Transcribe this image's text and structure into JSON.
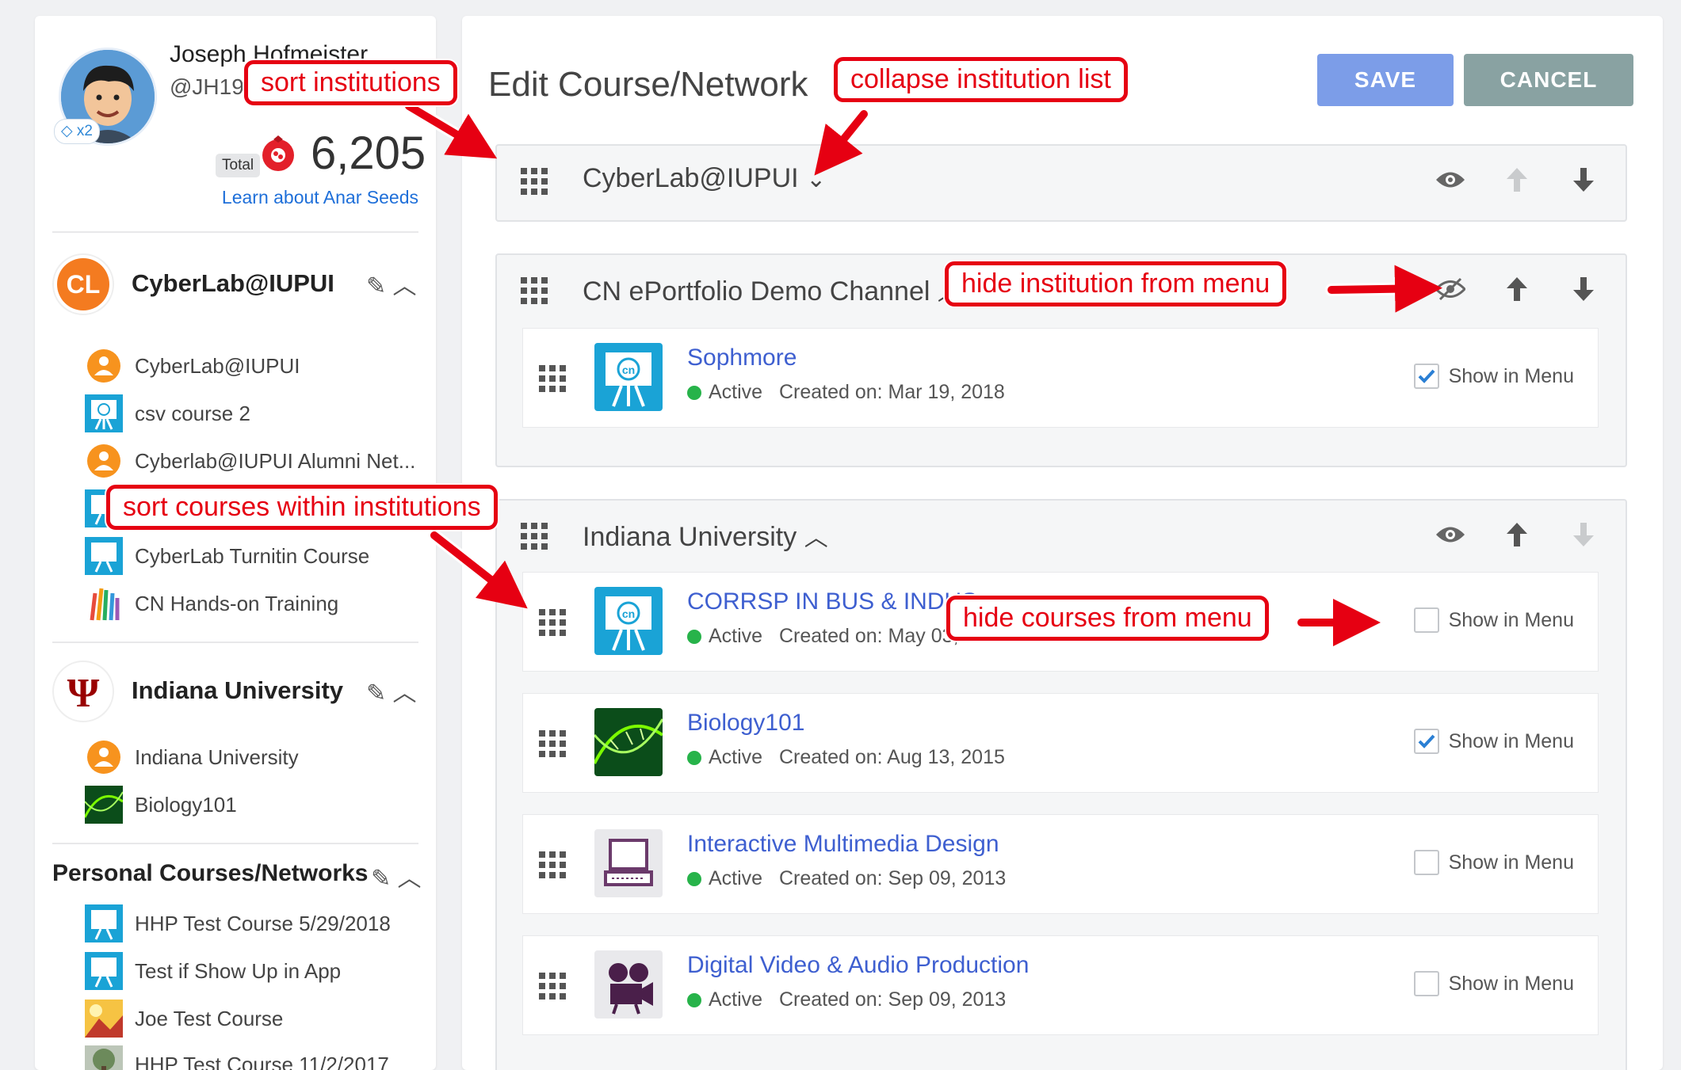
{
  "user": {
    "name": "Joseph Hofmeister",
    "handle": "@JH19",
    "gem_badge": "x2",
    "total_label": "Total",
    "points": "6,205",
    "learn_link": "Learn about Anar Seeds"
  },
  "sidebar": {
    "institutions": [
      {
        "title": "CyberLab@IUPUI",
        "logo": "CL",
        "items": [
          {
            "label": "CyberLab@IUPUI",
            "icon": "network-icon"
          },
          {
            "label": "csv course 2",
            "icon": "course-easel-icon"
          },
          {
            "label": "Cyberlab@IUPUI Alumni Net...",
            "icon": "network-icon"
          },
          {
            "label": "",
            "icon": "course-easel-icon"
          },
          {
            "label": "CyberLab Turnitin Course",
            "icon": "course-easel-icon"
          },
          {
            "label": "CN Hands-on Training",
            "icon": "hands-icon"
          }
        ]
      },
      {
        "title": "Indiana University",
        "logo": "IU",
        "items": [
          {
            "label": "Indiana University",
            "icon": "network-icon"
          },
          {
            "label": "Biology101",
            "icon": "biology-icon"
          }
        ]
      }
    ],
    "personal": {
      "title": "Personal Courses/Networks",
      "items": [
        {
          "label": "HHP Test Course 5/29/2018",
          "icon": "course-easel-icon"
        },
        {
          "label": "Test if Show Up in App",
          "icon": "course-easel-icon"
        },
        {
          "label": "Joe Test Course",
          "icon": "photo-icon"
        },
        {
          "label": "HHP Test Course 11/2/2017",
          "icon": "tree-icon"
        }
      ]
    }
  },
  "main": {
    "title": "Edit Course/Network",
    "save_label": "SAVE",
    "cancel_label": "CANCEL",
    "show_in_menu": "Show in Menu",
    "panels": [
      {
        "title": "CyberLab@IUPUI",
        "courses": []
      },
      {
        "title": "CN ePortfolio Demo Channel",
        "courses": [
          {
            "name": "Sophmore",
            "status": "Active",
            "created": "Created on: Mar 19, 2018",
            "show": true,
            "thumb": "course-easel-icon"
          }
        ]
      },
      {
        "title": "Indiana University",
        "courses": [
          {
            "name": "CORRSP IN BUS & INDUS",
            "status": "Active",
            "created": "Created on: May 03, 2017",
            "show": false,
            "thumb": "course-easel-icon"
          },
          {
            "name": "Biology101",
            "status": "Active",
            "created": "Created on: Aug 13, 2015",
            "show": true,
            "thumb": "biology-icon"
          },
          {
            "name": "Interactive Multimedia Design",
            "status": "Active",
            "created": "Created on: Sep 09, 2013",
            "show": false,
            "thumb": "computer-icon"
          },
          {
            "name": "Digital Video & Audio Production",
            "status": "Active",
            "created": "Created on: Sep 09, 2013",
            "show": false,
            "thumb": "film-projector-icon"
          }
        ]
      }
    ]
  },
  "annotations": {
    "sort_institutions": "sort institutions",
    "collapse_list": "collapse institution list",
    "hide_institution": "hide institution from menu",
    "sort_courses": "sort courses within institutions",
    "hide_courses": "hide courses from menu"
  },
  "colors": {
    "accent_link": "#3e5fd0",
    "save": "#7c9de8",
    "cancel": "#89a2a2",
    "active": "#27b34a",
    "annotation": "#e60012",
    "course_icon": "#1aa3d6"
  }
}
